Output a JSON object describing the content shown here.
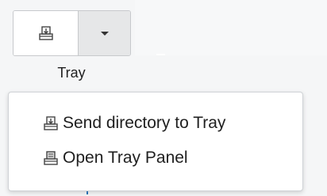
{
  "toolbar": {
    "tray_button_label": "Tray",
    "tray_icon": "tray-send-icon",
    "dropdown_icon": "chevron-down-icon"
  },
  "menu": {
    "items": [
      {
        "label": "Send directory to Tray",
        "icon": "tray-send-icon"
      },
      {
        "label": "Open Tray Panel",
        "icon": "tray-open-icon"
      }
    ]
  },
  "colors": {
    "dropdown_bg": "#e6e7e8",
    "border": "#c7c9cc",
    "text": "#1f1f1f"
  }
}
